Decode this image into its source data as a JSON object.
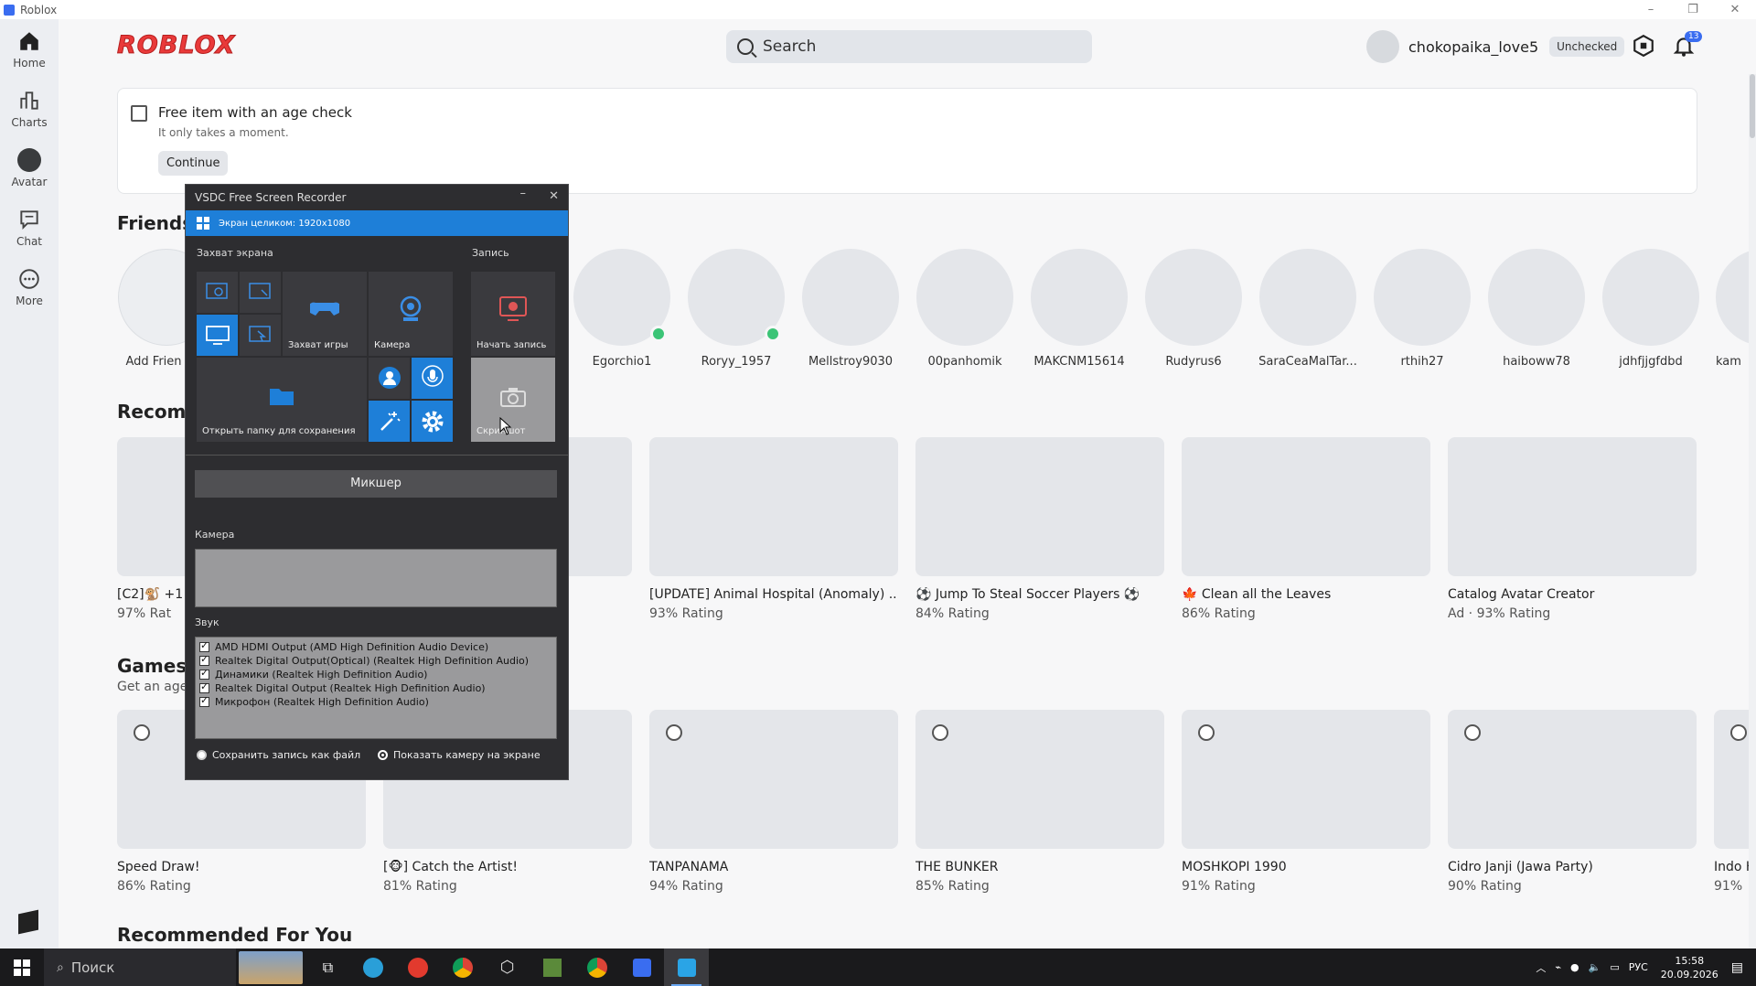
{
  "window": {
    "title": "Roblox",
    "minimize": "–",
    "restore": "❐",
    "close": "✕"
  },
  "nav": [
    {
      "label": "Home"
    },
    {
      "label": "Charts"
    },
    {
      "label": "Avatar"
    },
    {
      "label": "Chat"
    },
    {
      "label": "More"
    }
  ],
  "header": {
    "logo": "ROBLOX",
    "search_placeholder": "Search",
    "username": "chokopaika_love5",
    "unchecked": "Unchecked",
    "notifications": "13"
  },
  "banner": {
    "title": "Free item with an age check",
    "subtitle": "It only takes a moment.",
    "button": "Continue"
  },
  "friends": {
    "title": "Friends",
    "add_label": "Add Frien",
    "items": [
      {
        "name": "Egorchio1",
        "online": true
      },
      {
        "name": "Roryy_1957",
        "online": true
      },
      {
        "name": "Mellstroy9030",
        "online": false
      },
      {
        "name": "00panhomik",
        "online": false
      },
      {
        "name": "MAKCNM15614",
        "online": false
      },
      {
        "name": "Rudyrus6",
        "online": false
      },
      {
        "name": "SaraCeaMalTar...",
        "online": false
      },
      {
        "name": "rthih27",
        "online": false
      },
      {
        "name": "haiboww78",
        "online": false
      },
      {
        "name": "jdhfjjgfdbd",
        "online": false
      },
      {
        "name": "kam",
        "online": false
      }
    ]
  },
  "recommended": {
    "title": "Recomm",
    "items": [
      {
        "name": "[C2]🐒 +1 S",
        "rating": "97% Rat"
      },
      {
        "name": "",
        "rating": ""
      },
      {
        "name": "[UPDATE] Animal Hospital (Anomaly) ...",
        "rating": "93% Rating"
      },
      {
        "name": "⚽ Jump To Steal Soccer Players ⚽",
        "rating": "84% Rating"
      },
      {
        "name": "🍁 Clean all the Leaves",
        "rating": "86% Rating"
      },
      {
        "name": "Catalog Avatar Creator",
        "rating": "Ad · 93% Rating"
      }
    ]
  },
  "games_age": {
    "title": "Games v",
    "subtitle": "Get an age",
    "items": [
      {
        "name": "Speed Draw!",
        "rating": "86% Rating"
      },
      {
        "name": "[🐵] Catch the Artist!",
        "rating": "81% Rating"
      },
      {
        "name": "TANPANAMA",
        "rating": "94% Rating"
      },
      {
        "name": "THE BUNKER",
        "rating": "85% Rating"
      },
      {
        "name": "MOSHKOPI 1990",
        "rating": "91% Rating"
      },
      {
        "name": "Cidro Janji (Jawa Party)",
        "rating": "90% Rating"
      },
      {
        "name": "Indo H",
        "rating": "91%"
      }
    ]
  },
  "recommended_for_you": {
    "title": "Recommended For You"
  },
  "vsdc": {
    "title": "VSDC Free Screen Recorder",
    "min": "–",
    "close": "✕",
    "mode": "Экран целиком: 1920x1080",
    "capture_label": "Захват экрана",
    "record_label": "Запись",
    "game_capture": "Захват игры",
    "camera_btn": "Камера",
    "start_record": "Начать запись",
    "open_folder": "Открыть папку для сохранения",
    "screenshot": "Скриншот",
    "mixer": "Микшер",
    "camera_section": "Камера",
    "sound_section": "Звук",
    "sound_devices": [
      "AMD HDMI Output (AMD High Definition Audio Device)",
      "Realtek Digital Output(Optical) (Realtek High Definition Audio)",
      "Динамики (Realtek High Definition Audio)",
      "Realtek Digital Output (Realtek High Definition Audio)",
      "Микрофон (Realtek High Definition Audio)"
    ],
    "save_as_file": "Сохранить запись как файл",
    "show_camera": "Показать камеру на экране"
  },
  "taskbar": {
    "search": "Поиск",
    "lang": "РУС",
    "time": "15:58",
    "date": "20.09.2026"
  }
}
